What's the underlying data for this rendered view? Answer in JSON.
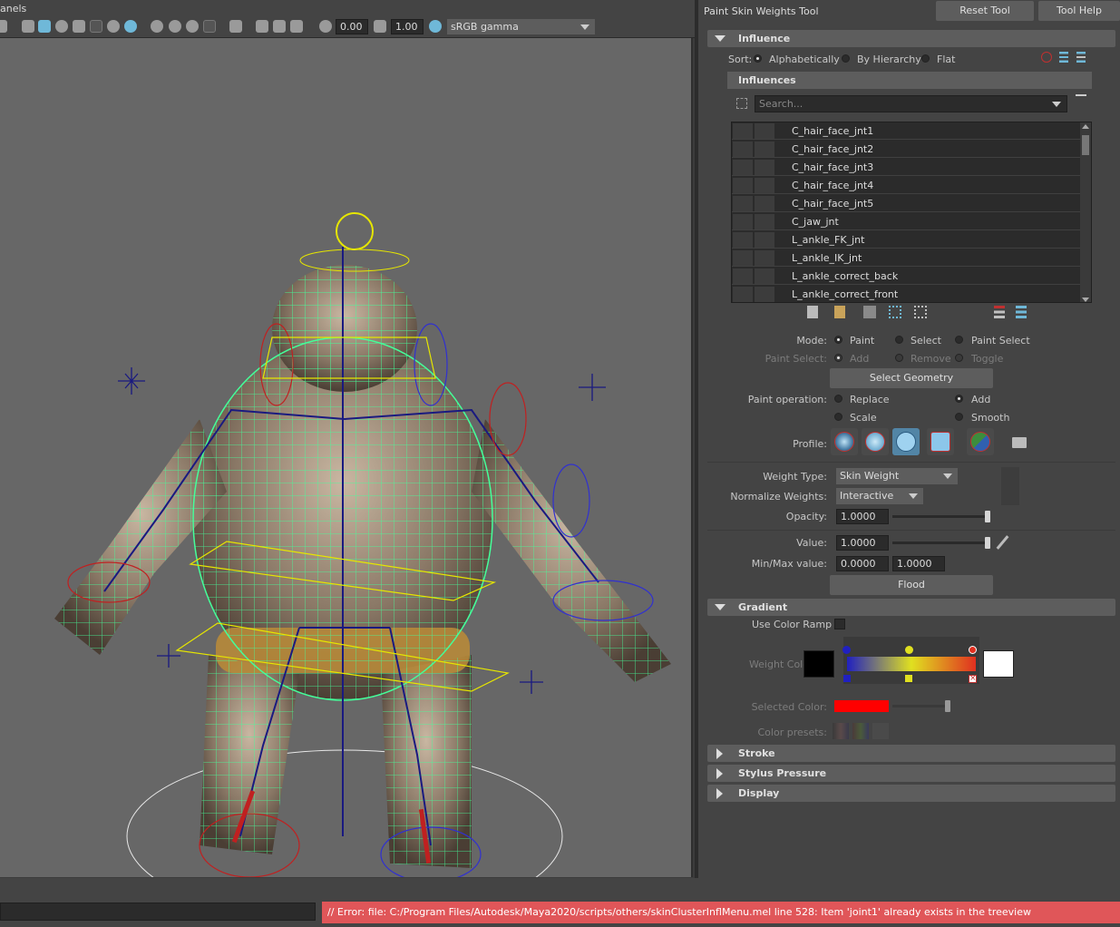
{
  "viewport": {
    "menu_partial": "anels",
    "toolbar": {
      "value1": "0.00",
      "value2": "1.00",
      "color_space": "sRGB gamma"
    },
    "icons": [
      "display-mode-icon",
      "wireframe-cube-icon",
      "shaded-cube-icon",
      "sphere-icon",
      "textured-icon",
      "xray-icon",
      "light-icon",
      "shadow-icon",
      "ao-icon",
      "motion-blur-icon",
      "aa-icon",
      "dof-icon",
      "isolate-icon",
      "xray-joints-icon",
      "xray-active-icon",
      "grid-icon",
      "exposure-icon",
      "gamma-icon",
      "color-mgmt-icon"
    ]
  },
  "tool": {
    "title": "Paint Skin Weights Tool",
    "reset_label": "Reset Tool",
    "help_label": "Tool Help"
  },
  "influence": {
    "header": "Influence",
    "sort_label": "Sort:",
    "sort_options": [
      "Alphabetically",
      "By Hierarchy",
      "Flat"
    ],
    "sort_selected": 0,
    "influences_header": "Influences",
    "search_placeholder": "Search...",
    "items": [
      "C_hair_face_jnt1",
      "C_hair_face_jnt2",
      "C_hair_face_jnt3",
      "C_hair_face_jnt4",
      "C_hair_face_jnt5",
      "C_jaw_jnt",
      "L_ankle_FK_jnt",
      "L_ankle_IK_jnt",
      "L_ankle_correct_back",
      "L_ankle_correct_front"
    ]
  },
  "paint": {
    "mode_label": "Mode:",
    "mode_options": [
      "Paint",
      "Select",
      "Paint Select"
    ],
    "paint_select_label": "Paint Select:",
    "paint_select_options": [
      "Add",
      "Remove",
      "Toggle"
    ],
    "select_geometry_label": "Select Geometry",
    "operation_label": "Paint operation:",
    "operation_options": [
      "Replace",
      "Add",
      "Scale",
      "Smooth"
    ],
    "operation_selected": "Add",
    "profile_label": "Profile:"
  },
  "weights": {
    "type_label": "Weight Type:",
    "type_value": "Skin Weight",
    "normalize_label": "Normalize Weights:",
    "normalize_value": "Interactive",
    "opacity_label": "Opacity:",
    "opacity_value": "1.0000",
    "opacity_level": 1.0,
    "value_label": "Value:",
    "value_value": "1.0000",
    "value_level": 1.0,
    "minmax_label": "Min/Max value:",
    "min_value": "0.0000",
    "max_value": "1.0000",
    "flood_label": "Flood"
  },
  "gradient": {
    "header": "Gradient",
    "use_ramp_label": "Use Color Ramp",
    "weight_color_label": "Weight Color:",
    "selected_color_label": "Selected Color:",
    "color_presets_label": "Color presets:",
    "colors": {
      "ramp_start": "#2020c0",
      "ramp_mid": "#e0e020",
      "ramp_end": "#e03020",
      "selected": "#ff0000"
    }
  },
  "collapsed_sections": [
    "Stroke",
    "Stylus Pressure",
    "Display"
  ],
  "error": {
    "message": "// Error: file: C:/Program Files/Autodesk/Maya2020/scripts/others/skinClusterInflMenu.mel line 528: Item 'joint1' already exists in the treeview"
  },
  "colors": {
    "panel_bg": "#444444",
    "viewport_bg": "#676767",
    "wire_green": "#44ff9a",
    "joint_blue": "#1a1a80",
    "error_bg": "#e05659",
    "accent_blue": "#6fb8d8"
  }
}
